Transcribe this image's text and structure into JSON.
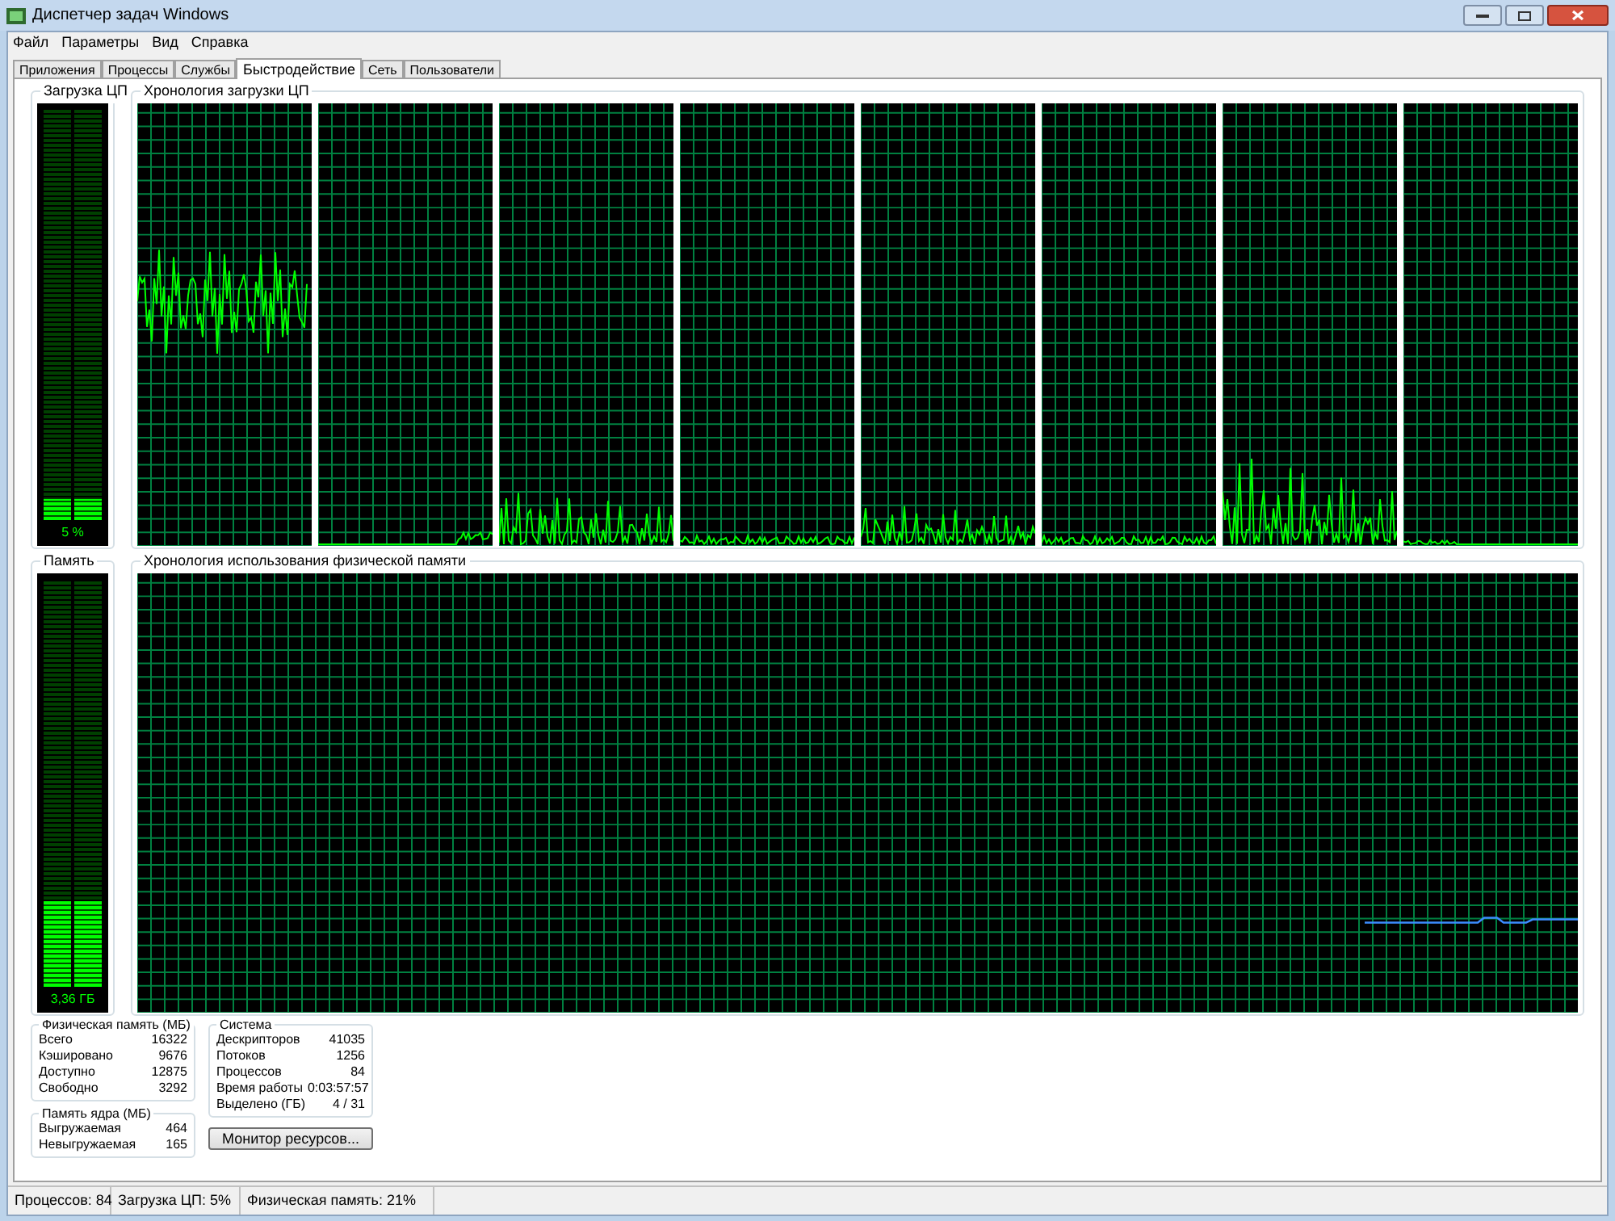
{
  "window": {
    "title": "Диспетчер задач Windows"
  },
  "menu": [
    "Файл",
    "Параметры",
    "Вид",
    "Справка"
  ],
  "tabs": [
    {
      "label": "Приложения",
      "selected": false
    },
    {
      "label": "Процессы",
      "selected": false
    },
    {
      "label": "Службы",
      "selected": false
    },
    {
      "label": "Быстродействие",
      "selected": true
    },
    {
      "label": "Сеть",
      "selected": false
    },
    {
      "label": "Пользователи",
      "selected": false
    }
  ],
  "cpu_meter": {
    "title": "Загрузка ЦП",
    "level": 0.05,
    "reading": "5 %"
  },
  "cpu_history": {
    "title": "Хронология загрузки ЦП",
    "graphs": [
      {
        "kind": "graph"
      },
      {
        "kind": "graph"
      },
      {
        "kind": "graph"
      },
      {
        "kind": "graph"
      },
      {
        "kind": "graph"
      },
      {
        "kind": "graph"
      },
      {
        "kind": "graph"
      },
      {
        "kind": "graph"
      }
    ]
  },
  "memory_meter": {
    "title": "Память",
    "level": 0.21,
    "reading": "3,36 ГБ"
  },
  "memory_history": {
    "title": "Хронология использования физической памяти"
  },
  "physical_memory": {
    "title": "Физическая память (МБ)",
    "rows": [
      {
        "label": "Всего",
        "value": "16322"
      },
      {
        "label": "Кэшировано",
        "value": "9676"
      },
      {
        "label": "Доступно",
        "value": "12875"
      },
      {
        "label": "Свободно",
        "value": "3292"
      }
    ]
  },
  "kernel_memory": {
    "title": "Память ядра (МБ)",
    "rows": [
      {
        "label": "Выгружаемая",
        "value": "464"
      },
      {
        "label": "Невыгружаемая",
        "value": "165"
      }
    ]
  },
  "system": {
    "title": "Система",
    "rows": [
      {
        "label": "Дескрипторов",
        "value": "41035"
      },
      {
        "label": "Потоков",
        "value": "1256"
      },
      {
        "label": "Процессов",
        "value": "84"
      },
      {
        "label": "Время работы",
        "value": "0:03:57:57"
      },
      {
        "label": "Выделено (ГБ)",
        "value": "4 / 31"
      }
    ]
  },
  "resource_monitor_button": "Монитор ресурсов...",
  "status_bar": [
    "Процессов: 84",
    "Загрузка ЦП: 5%",
    "Физическая память: 21%"
  ]
}
